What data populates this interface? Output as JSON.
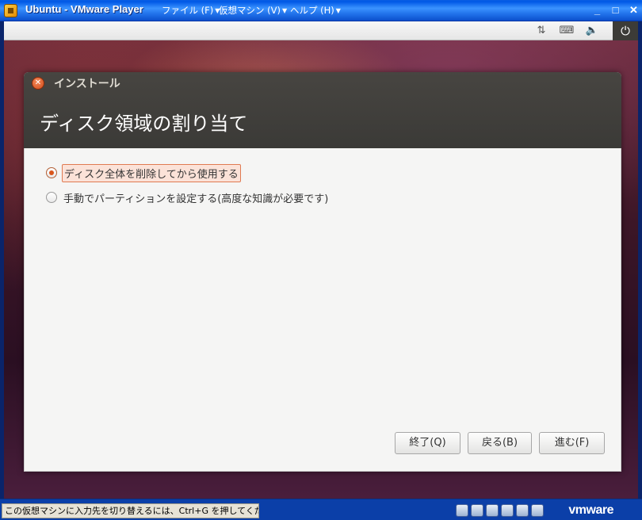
{
  "window": {
    "title": "Ubuntu - VMware Player",
    "menus": [
      {
        "label": "ファイル (F)"
      },
      {
        "label": "仮想マシン (V)"
      },
      {
        "label": "ヘルプ (H)"
      }
    ],
    "controls": {
      "minimize": "_",
      "maximize": "□",
      "close": "✕"
    }
  },
  "installer": {
    "window_title": "インストール",
    "heading": "ディスク領域の割り当て",
    "options": [
      {
        "label": "ディスク全体を削除してから使用する",
        "selected": true
      },
      {
        "label": "手動でパーティションを設定する(高度な知識が必要です)",
        "selected": false
      }
    ],
    "buttons": {
      "quit": "終了(Q)",
      "back": "戻る(B)",
      "forward": "進む(F)"
    }
  },
  "status_bar": {
    "message": "この仮想マシンに入力先を切り替えるには、Ctrl+G を押してください。",
    "brand": "vmware"
  },
  "colors": {
    "accent": "#d9561c",
    "header_bg": "#3b3a37",
    "xp_blue": "#0058e6"
  }
}
